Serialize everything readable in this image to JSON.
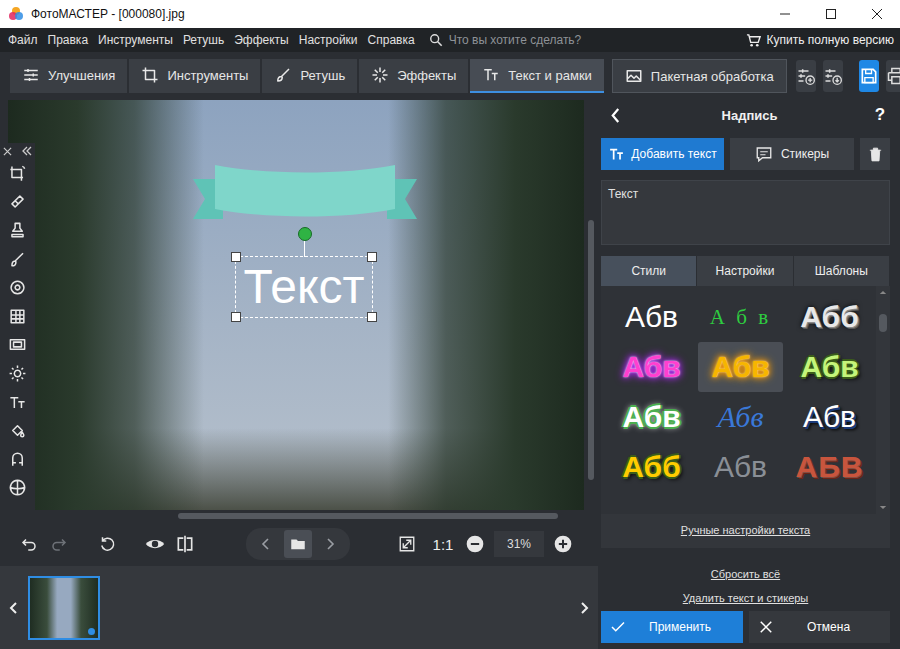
{
  "window": {
    "title": "ФотоМАСТЕР - [000080].jpg"
  },
  "menu": [
    "Файл",
    "Правка",
    "Инструменты",
    "Ретушь",
    "Эффекты",
    "Настройки",
    "Справка"
  ],
  "search": {
    "placeholder": "Что вы хотите сделать?"
  },
  "buy": "Купить полную версию",
  "tabs": [
    {
      "label": "Улучшения",
      "selected": false
    },
    {
      "label": "Инструменты",
      "selected": false
    },
    {
      "label": "Ретушь",
      "selected": false
    },
    {
      "label": "Эффекты",
      "selected": false
    },
    {
      "label": "Текст и рамки",
      "selected": true
    },
    {
      "label": "Пакетная обработка",
      "selected": false
    }
  ],
  "canvas": {
    "overlay_text": "Текст"
  },
  "view": {
    "actual_size": "1:1",
    "zoom": "31%",
    "redo_disabled": true
  },
  "filmstrip": [
    {
      "selected": true
    }
  ],
  "panel": {
    "title": "Надпись",
    "help": "?",
    "add_text": "Добавить текст",
    "stickers": "Стикеры",
    "text_value": "Текст",
    "tabs": [
      {
        "label": "Стили",
        "selected": true
      },
      {
        "label": "Настройки",
        "selected": false
      },
      {
        "label": "Шаблоны",
        "selected": false
      }
    ],
    "styles": [
      {
        "text": "Абв",
        "kind": "plain",
        "color": "#ffffff",
        "selected": false
      },
      {
        "text": "А б в",
        "kind": "spaced",
        "color": "#2ecc40",
        "selected": false
      },
      {
        "text": "Абб",
        "kind": "shadow",
        "color": "#e8e8e8",
        "selected": false
      },
      {
        "text": "Абв",
        "kind": "glow",
        "color": "#ff3fd0",
        "selected": false
      },
      {
        "text": "Абв",
        "kind": "warm",
        "color": "#f7b500",
        "selected": true
      },
      {
        "text": "Абв",
        "kind": "outline",
        "color": "#c4f57a",
        "selected": false
      },
      {
        "text": "Абв",
        "kind": "ring",
        "color": "#ffffff",
        "selected": false
      },
      {
        "text": "Абв",
        "kind": "italic",
        "color": "#3a78d8",
        "selected": false
      },
      {
        "text": "Абв",
        "kind": "deep",
        "color": "#ffffff",
        "selected": false
      },
      {
        "text": "Абб",
        "kind": "outline",
        "color": "#ffcc00",
        "selected": false
      },
      {
        "text": "Абв",
        "kind": "plain",
        "color": "#8a8f96",
        "selected": false
      },
      {
        "text": "АБВ",
        "kind": "dotted",
        "color": "#c8553d",
        "selected": false
      }
    ],
    "manual": "Ручные настройки текста",
    "reset": "Сбросить всё",
    "remove": "Удалить текст и стикеры",
    "apply": "Применить",
    "cancel": "Отмена"
  }
}
